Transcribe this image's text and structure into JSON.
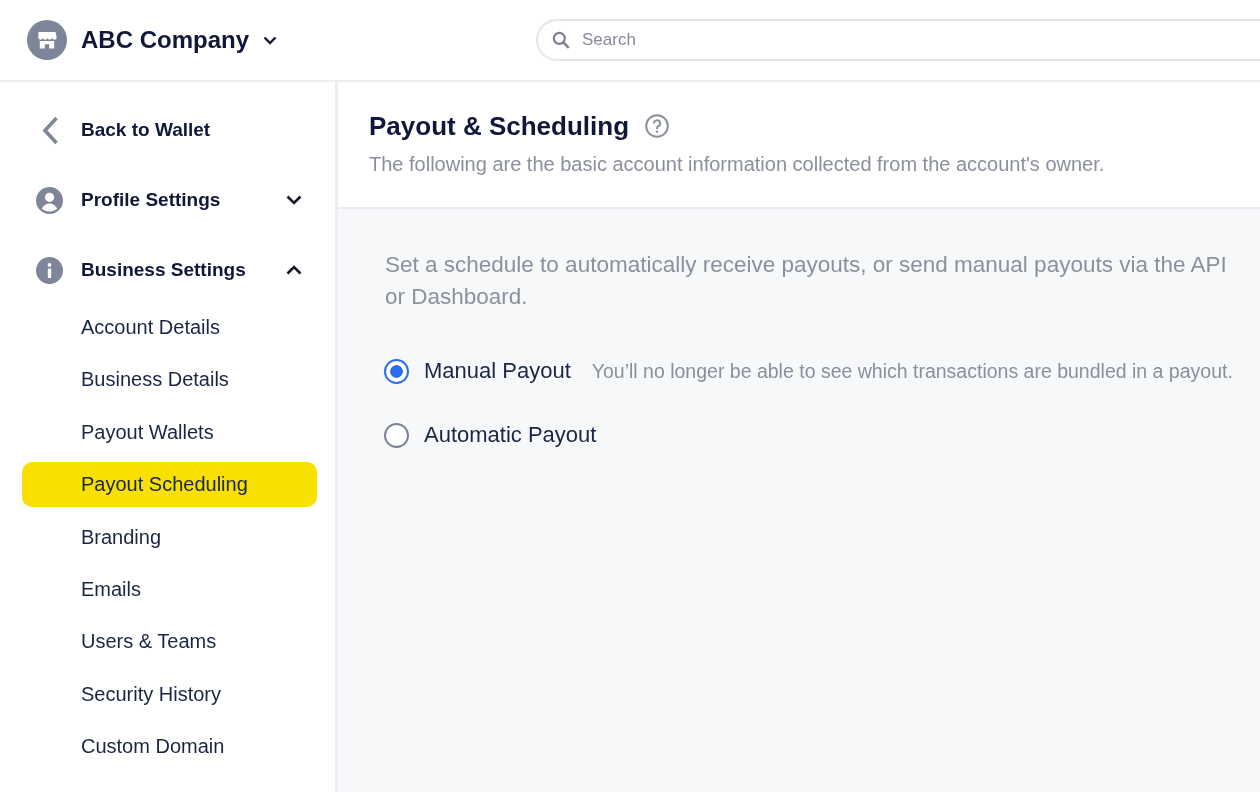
{
  "header": {
    "company_switcher": {
      "name": "ABC Company"
    },
    "search": {
      "placeholder": "Search"
    }
  },
  "sidebar": {
    "back_link": {
      "label": "Back to Wallet"
    },
    "sections": [
      {
        "label": "Profile Settings",
        "expanded": false
      },
      {
        "label": "Business Settings",
        "expanded": true,
        "children": [
          {
            "label": "Account Details",
            "selected": false
          },
          {
            "label": "Business Details",
            "selected": false
          },
          {
            "label": "Payout Wallets",
            "selected": false
          },
          {
            "label": "Payout Scheduling",
            "selected": true
          },
          {
            "label": "Branding",
            "selected": false
          },
          {
            "label": "Emails",
            "selected": false
          },
          {
            "label": "Users & Teams",
            "selected": false
          },
          {
            "label": "Security History",
            "selected": false
          },
          {
            "label": "Custom Domain",
            "selected": false
          }
        ]
      }
    ]
  },
  "page": {
    "title": "Payout & Scheduling",
    "subtitle": "The following are the basic account information collected from the account's owner.",
    "description": "Set a schedule to automatically receive payouts, or send manual payouts via the API or Dashboard.",
    "payout_options": [
      {
        "label": "Manual Payout",
        "hint": "You’ll no longer be able to see which transactions are bundled in a payout.",
        "selected": true
      },
      {
        "label": "Automatic Payout",
        "selected": false
      }
    ]
  }
}
